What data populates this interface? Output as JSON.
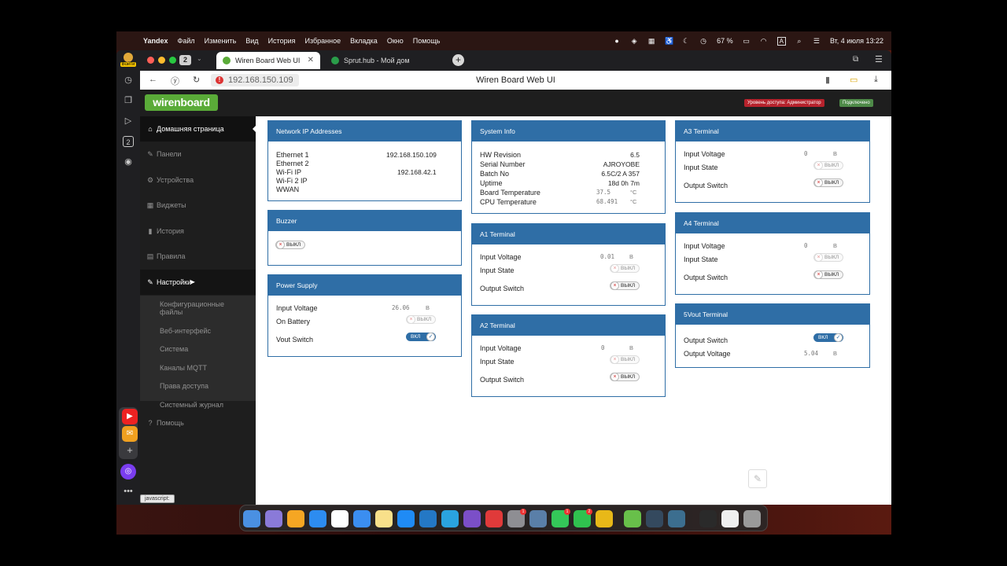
{
  "menubar": {
    "app": "Yandex",
    "items": [
      "Файл",
      "Изменить",
      "Вид",
      "История",
      "Избранное",
      "Вкладка",
      "Окно",
      "Помощь"
    ],
    "battery": "67 %",
    "input_source": "A",
    "datetime": "Вт, 4 июля  13:22"
  },
  "browser": {
    "profile_label": "Войти",
    "tab_count": "2",
    "tabs": [
      {
        "title": "Wiren Board Web UI",
        "fav_color": "#5aab38"
      },
      {
        "title": "Sprut.hub - Мой дом",
        "fav_color": "#2a9d4a"
      }
    ],
    "url": "192.168.150.109",
    "page_title": "Wiren Board Web UI",
    "status_url": "javascript:"
  },
  "header": {
    "logo": "wirenboard",
    "access": "Уровень доступа: Администратор",
    "connection": "Подключено"
  },
  "sidebar": {
    "items": [
      {
        "icon": "home-icon",
        "glyph": "⌂",
        "label": "Домашняя страница"
      },
      {
        "icon": "wrench-icon",
        "glyph": "✎",
        "label": "Панели"
      },
      {
        "icon": "gear-icon",
        "glyph": "⚙",
        "label": "Устройства"
      },
      {
        "icon": "widgets-icon",
        "glyph": "▦",
        "label": "Виджеты"
      },
      {
        "icon": "bar-chart-icon",
        "glyph": "▮",
        "label": "История"
      },
      {
        "icon": "document-icon",
        "glyph": "▤",
        "label": "Правила"
      },
      {
        "icon": "wrench-icon",
        "glyph": "✎",
        "label": "Настройки"
      },
      {
        "icon": "help-icon",
        "glyph": "?",
        "label": "Помощь"
      }
    ],
    "submenu": [
      "Конфигурационные файлы",
      "Веб-интерфейс",
      "Система",
      "Каналы MQTT",
      "Права доступа",
      "Системный журнал"
    ]
  },
  "panels": {
    "network": {
      "title": "Network IP Addresses",
      "rows": [
        {
          "label": "Ethernet 1",
          "value": "192.168.150.109"
        },
        {
          "label": "Ethernet 2",
          "value": ""
        },
        {
          "label": "Wi-Fi IP",
          "value": "192.168.42.1"
        },
        {
          "label": "Wi-Fi 2 IP",
          "value": ""
        },
        {
          "label": "WWAN",
          "value": ""
        }
      ]
    },
    "buzzer": {
      "title": "Buzzer",
      "toggle": "ВЫКЛ"
    },
    "power": {
      "title": "Power Supply",
      "input_voltage_label": "Input Voltage",
      "input_voltage": "26.06",
      "unit": "В",
      "on_battery_label": "On Battery",
      "on_battery": "ВЫКЛ",
      "vout_label": "Vout Switch",
      "vout": "ВКЛ"
    },
    "system": {
      "title": "System Info",
      "rows": [
        {
          "label": "HW Revision",
          "value": "6.5"
        },
        {
          "label": "Serial Number",
          "value": "AJROYOBE"
        },
        {
          "label": "Batch No",
          "value": "6.5C/2 A 357"
        },
        {
          "label": "Uptime",
          "value": "18d 0h 7m"
        }
      ],
      "board_temp_label": "Board Temperature",
      "board_temp": "37.5",
      "cpu_temp_label": "CPU Temperature",
      "cpu_temp": "68.491",
      "temp_unit": "°C"
    },
    "a1": {
      "title": "A1 Terminal",
      "iv_label": "Input Voltage",
      "iv": "0.01",
      "unit": "В",
      "is_label": "Input State",
      "is": "ВЫКЛ",
      "os_label": "Output Switch",
      "os": "ВЫКЛ"
    },
    "a2": {
      "title": "A2 Terminal",
      "iv_label": "Input Voltage",
      "iv": "0",
      "unit": "В",
      "is_label": "Input State",
      "is": "ВЫКЛ",
      "os_label": "Output Switch",
      "os": "ВЫКЛ"
    },
    "a3": {
      "title": "A3 Terminal",
      "iv_label": "Input Voltage",
      "iv": "0",
      "unit": "В",
      "is_label": "Input State",
      "is": "ВЫКЛ",
      "os_label": "Output Switch",
      "os": "ВЫКЛ"
    },
    "a4": {
      "title": "A4 Terminal",
      "iv_label": "Input Voltage",
      "iv": "0",
      "unit": "В",
      "is_label": "Input State",
      "is": "ВЫКЛ",
      "os_label": "Output Switch",
      "os": "ВЫКЛ"
    },
    "vout5": {
      "title": "5Vout Terminal",
      "os_label": "Output Switch",
      "os": "ВКЛ",
      "ov_label": "Output Voltage",
      "ov": "5.04",
      "unit": "В"
    }
  },
  "colors": {
    "accent": "#2f6ea6",
    "logo": "#5aab38",
    "access_badge": "#b6222c",
    "connected_badge": "#4e8a48"
  }
}
